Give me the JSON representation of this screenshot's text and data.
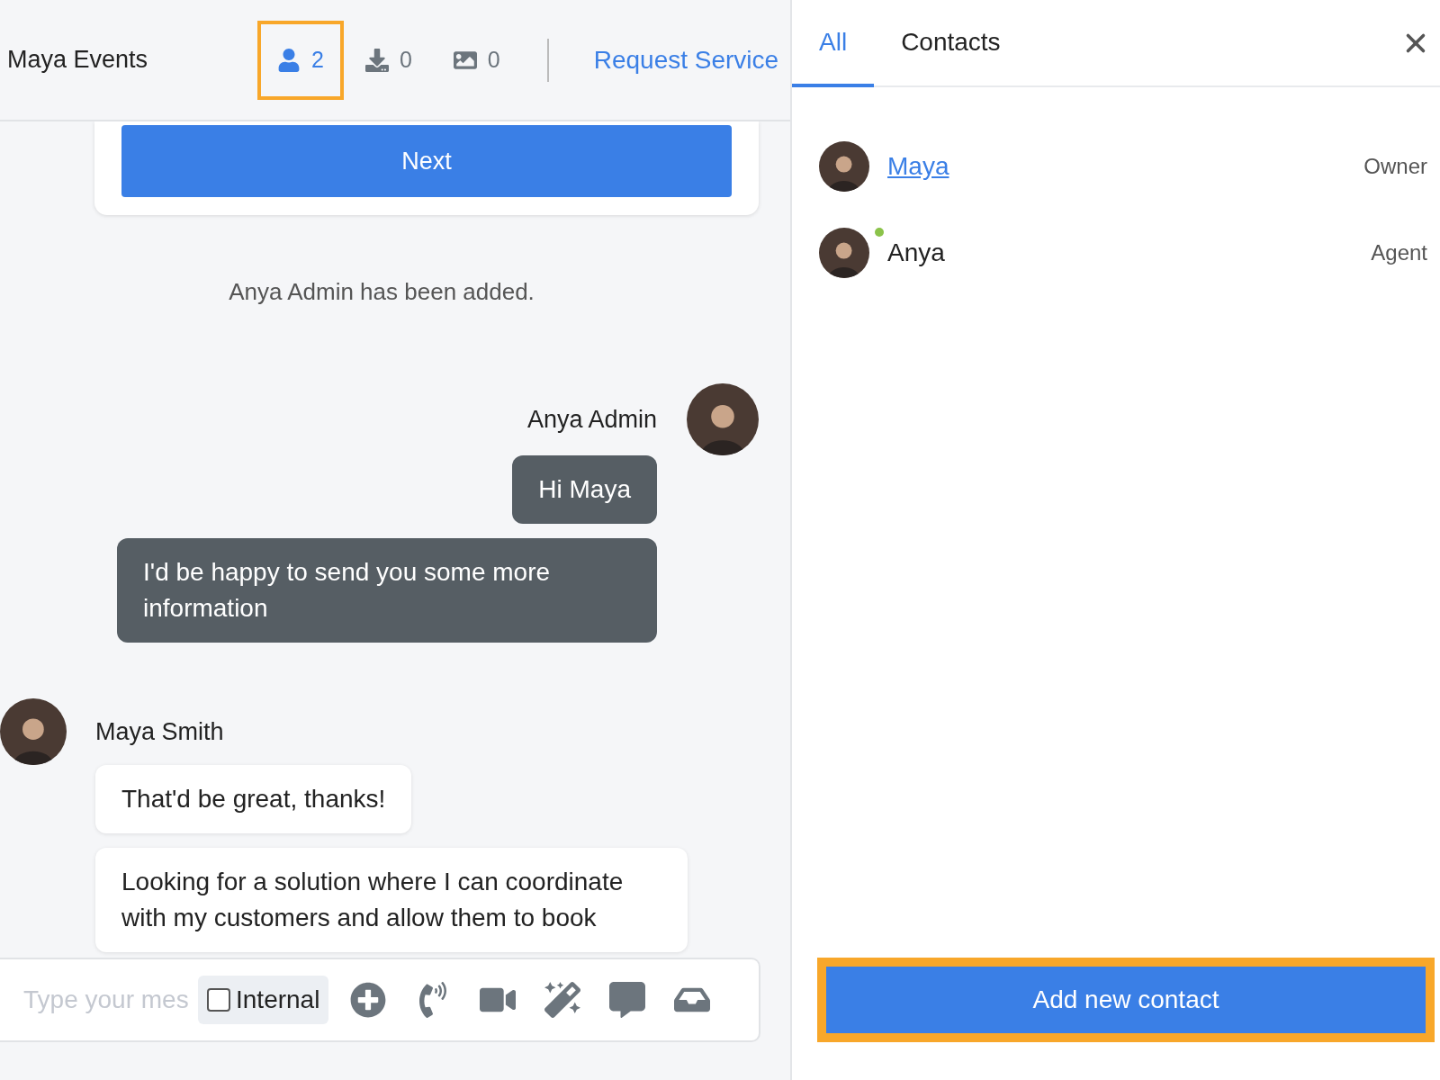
{
  "header": {
    "title": "Maya Events",
    "counters": [
      {
        "kind": "people",
        "count": "2",
        "active": true,
        "highlighted": true
      },
      {
        "kind": "downloads",
        "count": "0",
        "active": false,
        "highlighted": false
      },
      {
        "kind": "images",
        "count": "0",
        "active": false,
        "highlighted": false
      }
    ],
    "link": "Request Service"
  },
  "chat": {
    "card_button": "Next",
    "system_note": "Anya Admin has been added.",
    "groups": [
      {
        "outgoing": true,
        "sender": "Anya Admin",
        "messages": [
          "Hi Maya",
          "I'd be happy to send you some more information"
        ]
      },
      {
        "outgoing": false,
        "sender": "Maya Smith",
        "messages": [
          "That'd be great, thanks!",
          "Looking for a solution where I can coordinate with my customers and allow them to book"
        ]
      }
    ]
  },
  "composer": {
    "placeholder": "Type your mes",
    "internal": {
      "label": "Internal",
      "checked": false
    }
  },
  "panel": {
    "tabs": [
      {
        "label": "All",
        "selected": true
      },
      {
        "label": "Contacts",
        "selected": false
      }
    ],
    "contacts": [
      {
        "name": "Maya",
        "role": "Owner",
        "link": true,
        "online": false
      },
      {
        "name": "Anya",
        "role": "Agent",
        "link": false,
        "online": true,
        "color": "#8bc34a"
      }
    ],
    "add_button": {
      "label": "Add new contact",
      "highlighted": true
    }
  }
}
